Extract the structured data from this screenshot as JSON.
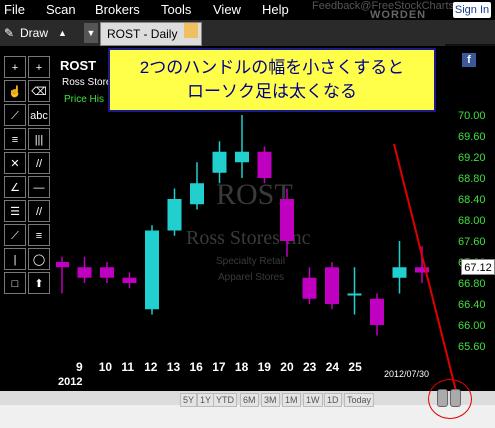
{
  "menu": [
    "File",
    "Scan",
    "Brokers",
    "Tools",
    "View",
    "Help"
  ],
  "feedback": "Feedback@FreeStockCharts",
  "brand": "WORDEN",
  "signin": "Sign In",
  "draw_label": "Draw",
  "tab_label": "ROST - Daily",
  "chart": {
    "symbol": "ROST",
    "company": "Ross Stores",
    "price_label": "Price His",
    "watermark_symbol": "ROST",
    "watermark_company": "Ross Stores Inc",
    "watermark_sector": "Specialty Retail",
    "watermark_industry": "Apparel Stores",
    "price_ticks": [
      "70.00",
      "69.60",
      "69.20",
      "68.80",
      "68.40",
      "68.00",
      "67.60",
      "67.20",
      "66.80",
      "66.40",
      "66.00",
      "65.60"
    ],
    "last_price": "67.12",
    "date_ticks": [
      "9",
      "10",
      "11",
      "12",
      "13",
      "16",
      "17",
      "18",
      "19",
      "20",
      "23",
      "24",
      "25"
    ],
    "year_label": "2012",
    "end_date": "2012/07/30"
  },
  "chart_data": {
    "type": "candlestick",
    "ylim": [
      65.4,
      70.2
    ],
    "candles": [
      {
        "o": 67.2,
        "c": 67.1,
        "h": 67.3,
        "l": 66.6,
        "color": "magenta"
      },
      {
        "o": 67.1,
        "c": 66.9,
        "h": 67.3,
        "l": 66.8,
        "color": "magenta"
      },
      {
        "o": 67.1,
        "c": 66.9,
        "h": 67.2,
        "l": 66.8,
        "color": "magenta"
      },
      {
        "o": 66.9,
        "c": 66.8,
        "h": 67.0,
        "l": 66.7,
        "color": "magenta"
      },
      {
        "o": 66.3,
        "c": 67.8,
        "h": 67.9,
        "l": 66.2,
        "color": "cyan"
      },
      {
        "o": 67.8,
        "c": 68.4,
        "h": 68.6,
        "l": 67.7,
        "color": "cyan"
      },
      {
        "o": 68.3,
        "c": 68.7,
        "h": 69.1,
        "l": 68.2,
        "color": "cyan"
      },
      {
        "o": 68.9,
        "c": 69.3,
        "h": 69.5,
        "l": 68.7,
        "color": "cyan"
      },
      {
        "o": 69.1,
        "c": 69.3,
        "h": 70.0,
        "l": 68.8,
        "color": "cyan"
      },
      {
        "o": 69.3,
        "c": 68.8,
        "h": 69.4,
        "l": 68.7,
        "color": "magenta"
      },
      {
        "o": 68.4,
        "c": 67.6,
        "h": 68.6,
        "l": 67.3,
        "color": "magenta"
      },
      {
        "o": 66.9,
        "c": 66.5,
        "h": 67.1,
        "l": 66.4,
        "color": "magenta"
      },
      {
        "o": 67.1,
        "c": 66.4,
        "h": 67.2,
        "l": 66.3,
        "color": "magenta"
      },
      {
        "o": 66.6,
        "c": 66.6,
        "h": 67.1,
        "l": 66.2,
        "color": "cyan"
      },
      {
        "o": 66.5,
        "c": 66.0,
        "h": 66.6,
        "l": 65.8,
        "color": "magenta"
      },
      {
        "o": 66.9,
        "c": 67.1,
        "h": 67.6,
        "l": 66.6,
        "color": "cyan"
      },
      {
        "o": 67.1,
        "c": 67.0,
        "h": 67.5,
        "l": 66.8,
        "color": "magenta"
      }
    ]
  },
  "balloon": {
    "line1": "2つのハンドルの幅を小さくすると",
    "line2": "ローソク足は太くなる"
  },
  "zoom_buttons": [
    "5Y",
    "1Y",
    "YTD",
    "6M",
    "3M",
    "1M",
    "1W",
    "1D",
    "Today"
  ],
  "tools": [
    "+",
    "+",
    "☝",
    "⌫",
    "⟋",
    "abc",
    "≡",
    "|||",
    "✕",
    "//",
    "∠",
    "—",
    "☰",
    "//",
    "⟋",
    "≡",
    "|",
    "◯",
    "□",
    "⬆"
  ]
}
